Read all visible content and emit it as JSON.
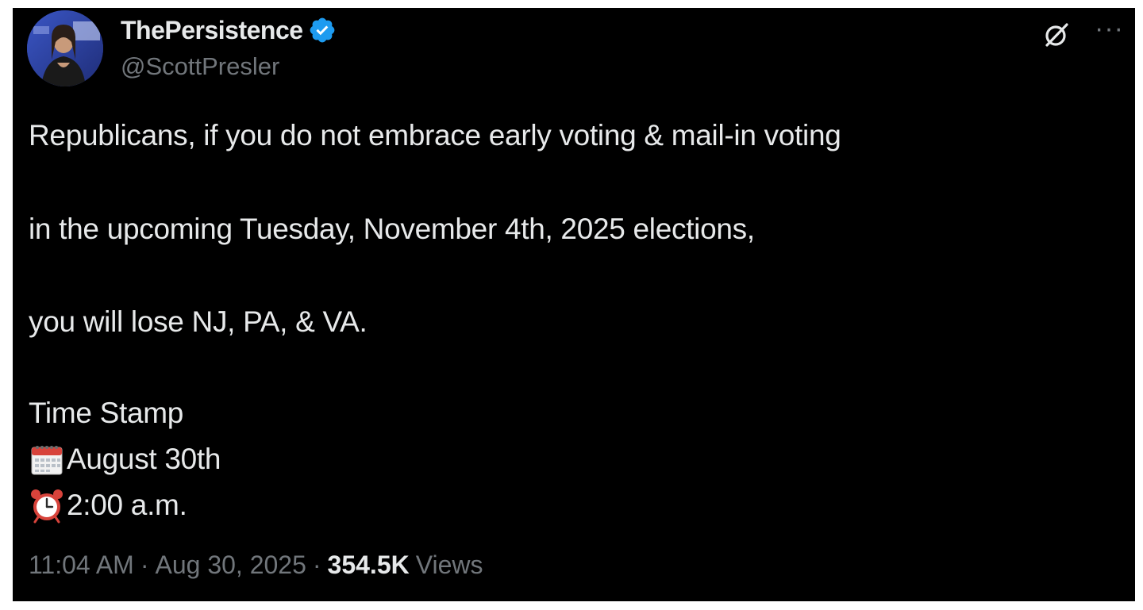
{
  "author": {
    "display_name": "ThePersistence",
    "handle": "@ScottPresler",
    "verified": true,
    "avatar_icon": "profile-photo",
    "badge_color": "#1d9bf0"
  },
  "tweet": {
    "lines": [
      "Republicans, if you do not embrace early voting & mail-in voting",
      "in the upcoming Tuesday, November 4th, 2025 elections,",
      "you will lose NJ, PA, & VA.",
      "Time Stamp",
      "August 30th",
      "2:00 a.m."
    ],
    "emoji": {
      "calendar": "calendar-emoji",
      "alarm_clock": "alarm-clock-emoji"
    }
  },
  "meta": {
    "time": "11:04 AM",
    "separator": "·",
    "date": "Aug 30, 2025",
    "views_count": "354.5K",
    "views_label": "Views"
  },
  "actions": {
    "grok_icon": "grok-icon",
    "more_icon": "more-icon",
    "more_glyph": "···"
  },
  "colors": {
    "background": "#000000",
    "text_primary": "#e7e9ea",
    "text_secondary": "#71767b",
    "verified_blue": "#1d9bf0"
  }
}
